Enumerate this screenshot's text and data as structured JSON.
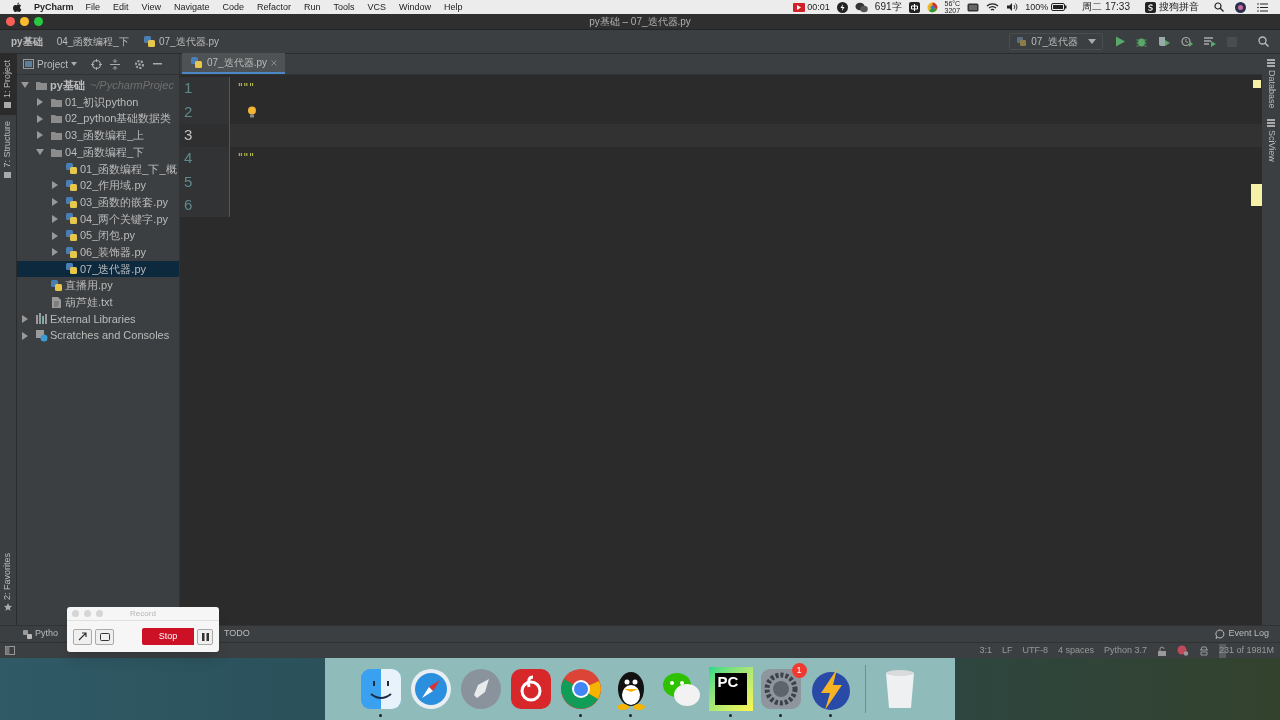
{
  "menubar": {
    "app": "PyCharm",
    "menus": [
      "File",
      "Edit",
      "View",
      "Navigate",
      "Code",
      "Refactor",
      "Run",
      "Tools",
      "VCS",
      "Window",
      "Help"
    ],
    "status": {
      "recording_time": "00:01",
      "word_count": "691字",
      "cpu_temp": "56°C",
      "fan_speed": "3207",
      "battery": "100%",
      "clock": "周二 17:33",
      "input_method": "搜狗拼音"
    }
  },
  "window": {
    "title": "py基础 – 07_迭代器.py"
  },
  "breadcrumbs": [
    {
      "label": "py基础",
      "kind": "project"
    },
    {
      "label": "04_函数编程_下",
      "kind": "folder"
    },
    {
      "label": "07_迭代器.py",
      "kind": "python"
    }
  ],
  "run_config": {
    "label": "07_迭代器"
  },
  "left_tool_tabs": [
    {
      "label": "1: Project",
      "selected": true,
      "kind": "panel"
    },
    {
      "label": "7: Structure",
      "selected": false,
      "kind": "panel"
    },
    {
      "label": "2: Favorites",
      "selected": false,
      "kind": "favorites"
    }
  ],
  "project_panel": {
    "title": "Project",
    "tree": [
      {
        "label": "py基础",
        "path": "~/PycharmProjec",
        "kind": "folder",
        "expanded": true,
        "selected": false,
        "children": [
          {
            "label": "01_初识python",
            "kind": "folder",
            "expanded": false,
            "selected": false
          },
          {
            "label": "02_python基础数据类",
            "kind": "folder",
            "expanded": false,
            "selected": false
          },
          {
            "label": "03_函数编程_上",
            "kind": "folder",
            "expanded": false,
            "selected": false
          },
          {
            "label": "04_函数编程_下",
            "kind": "folder",
            "expanded": true,
            "selected": false,
            "children": [
              {
                "label": "01_函数编程_下_概",
                "kind": "python",
                "selected": false
              },
              {
                "label": "02_作用域.py",
                "kind": "python",
                "expanded": false,
                "selected": false
              },
              {
                "label": "03_函数的嵌套.py",
                "kind": "python",
                "expanded": false,
                "selected": false
              },
              {
                "label": "04_两个关键字.py",
                "kind": "python",
                "expanded": false,
                "selected": false
              },
              {
                "label": "05_闭包.py",
                "kind": "python",
                "expanded": false,
                "selected": false
              },
              {
                "label": "06_装饰器.py",
                "kind": "python",
                "expanded": false,
                "selected": false
              },
              {
                "label": "07_迭代器.py",
                "kind": "python",
                "selected": true
              }
            ]
          },
          {
            "label": "直播用.py",
            "kind": "python",
            "selected": false
          },
          {
            "label": "葫芦娃.txt",
            "kind": "text",
            "selected": false
          }
        ]
      },
      {
        "label": "External Libraries",
        "kind": "libraries",
        "expanded": false,
        "selected": false
      },
      {
        "label": "Scratches and Consoles",
        "kind": "scratches",
        "expanded": false,
        "selected": false
      }
    ]
  },
  "editor": {
    "tabs": [
      {
        "label": "07_迭代器.py",
        "selected": true
      }
    ],
    "lines": [
      {
        "number": "1",
        "text": "\"\"\"",
        "current": false,
        "bulb": false
      },
      {
        "number": "2",
        "current": false,
        "bulb": true
      },
      {
        "number": "3",
        "current": true,
        "bulb": false
      },
      {
        "number": "4",
        "text": "\"\"\"",
        "current": false,
        "bulb": false
      },
      {
        "number": "5",
        "current": false,
        "bulb": false
      },
      {
        "number": "6",
        "current": false,
        "bulb": false
      }
    ]
  },
  "right_tool_tabs": [
    "Database",
    "SciView"
  ],
  "bottom_tool_tabs": [
    "Pytho",
    "TODO"
  ],
  "event_log": "Event Log",
  "status_bar": [
    "3:1",
    "LF",
    "UTF-8",
    "4 spaces",
    "Python 3.7"
  ],
  "memory": {
    "label": "231 of 1981M",
    "level": 0.12
  },
  "record_window": {
    "title": "Record",
    "stop": "Stop"
  },
  "dock": [
    {
      "kind": "finder",
      "running": true
    },
    {
      "kind": "safari",
      "running": false
    },
    {
      "kind": "launchpad",
      "running": false
    },
    {
      "kind": "music",
      "running": false
    },
    {
      "kind": "chrome",
      "running": true
    },
    {
      "kind": "qq",
      "running": true
    },
    {
      "kind": "wechat",
      "running": false
    },
    {
      "kind": "pycharm",
      "glyph": "PC",
      "running": true
    },
    {
      "kind": "settings",
      "badge": "1",
      "running": true
    },
    {
      "kind": "lightning",
      "running": true
    },
    {
      "kind": "trash",
      "running": false
    }
  ]
}
